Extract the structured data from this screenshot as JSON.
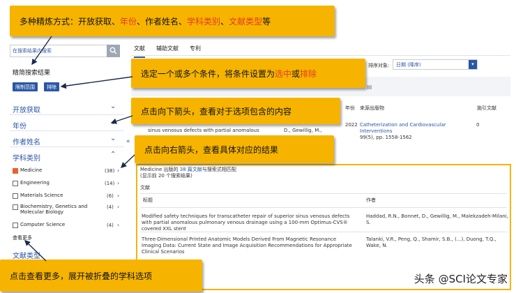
{
  "callouts": {
    "refine_methods_pre": "多种精炼方式：开放获取、",
    "refine_methods_year": "年份",
    "refine_methods_mid": "、作者姓名、",
    "refine_methods_subject": "学科类别",
    "refine_methods_sep": "、",
    "refine_methods_doctype": "文献类型",
    "refine_methods_post": "等",
    "select_condition_pre": "选定一个或多个条件，将条件设置为",
    "select_condition_select": "选中",
    "select_condition_or": "或",
    "select_condition_exclude": "排除",
    "down_arrow": "点击向下箭头，查看对于选项包含的内容",
    "right_arrow": "点击向右箭头，查看具体对应的结果",
    "see_more": "点击查看更多，展开被折叠的学科选项"
  },
  "sidebar": {
    "search_placeholder": "在搜索结果内搜索",
    "refine_title": "精简搜索结果",
    "limit_button": "限制范围",
    "exclude_button": "排除",
    "facets": {
      "open_access": "开放获取",
      "year": "年份",
      "author": "作者姓名",
      "subject": "学科类别",
      "doctype": "文献类型"
    },
    "subjects": [
      {
        "label": "Medicine",
        "count": "(38)",
        "checked": true
      },
      {
        "label": "Engineering",
        "count": "(14)",
        "checked": false
      },
      {
        "label": "Materials Science",
        "count": "(6)",
        "checked": false
      },
      {
        "label": "Biochemistry, Genetics and Molecular Biology",
        "count": "(4)",
        "checked": false
      },
      {
        "label": "Computer Science",
        "count": "(4)",
        "checked": false
      }
    ],
    "see_more": "查看更多"
  },
  "main": {
    "tabs": [
      "文献",
      "辅助文献",
      "专利"
    ],
    "sort_label": "排序对象:",
    "sort_value": "日期 (降序)",
    "columns": {
      "year": "年份",
      "source": "来源出版物",
      "cited": "施引文献"
    },
    "row1": {
      "title_frag": "sinus venosus defects with partial anomalous",
      "authors": "D., Gewillig, M.,",
      "year": "2022",
      "source": "Catheterization and Cardiovascular Interventions",
      "source_detail": "99(5), pp. 1558-1562",
      "cited": "0"
    }
  },
  "popup": {
    "header_pre": "Medicine 出版的",
    "header_count": "38 篇文献",
    "header_post": "与搜索式相匹配",
    "subheader": "(显示前 20 个搜索结果)",
    "section": "文献",
    "col_title": "标题",
    "col_author": "作者",
    "rows": [
      {
        "title": "Modified safety techniques for transcatheter repair of superior sinus venosus defects with partial anomalous pulmonary venous drainage using a 100-mm Optimus-CVS® covered XXL stent",
        "authors": "Haddad, R.N., Bonnet, D., Gewillig, M., Malekzadeh-Milani, S."
      },
      {
        "title": "Three-Dimensional Printed Anatomic Models Derived From Magnetic Resonance Imaging Data: Current State and Image Acquisition Recommendations for Appropriate Clinical Scenarios",
        "authors": "Talanki, V.R., Peng, Q., Shamir, S.B., (...), Duong, T.Q., Wake, N."
      }
    ]
  },
  "watermark": "头条 @SCI论文专家",
  "colors": {
    "callout": "#f6b400",
    "accent": "#2a56a6",
    "highlight_red": "#e53a1e"
  }
}
